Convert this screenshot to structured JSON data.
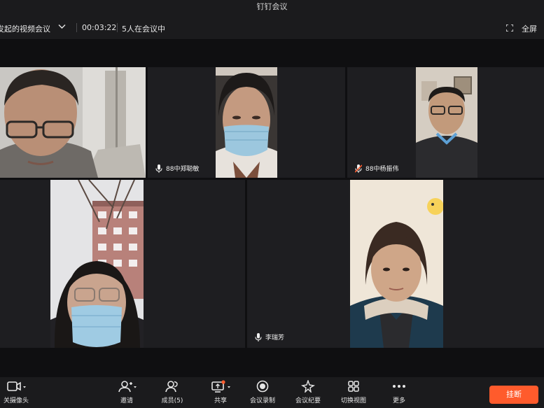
{
  "window": {
    "title": "钉钉会议"
  },
  "infobar": {
    "meeting_name": "发起的视频会议",
    "timer": "00:03:22",
    "participant_count": "5人在会议中",
    "fullscreen_label": "全屏"
  },
  "participants": [
    {
      "name": "",
      "mic": "on",
      "active_speaker": true
    },
    {
      "name": "88中郑聪敏",
      "mic": "on"
    },
    {
      "name": "88中杨振伟",
      "mic": "muted"
    },
    {
      "name": "",
      "mic": "none"
    },
    {
      "name": "李瑞芳",
      "mic": "on"
    }
  ],
  "toolbar": {
    "camera": "关摄像头",
    "invite": "邀请",
    "members": "成员(5)",
    "share": "共享",
    "record": "会议录制",
    "minutes": "会议纪要",
    "switch_view": "切换视图",
    "more": "更多",
    "hangup": "挂断"
  },
  "colors": {
    "accent_active": "#2fbf6f",
    "hangup": "#ff5b2c",
    "share_dot": "#ff5b2c",
    "muted_mic": "#ff5b2c"
  }
}
